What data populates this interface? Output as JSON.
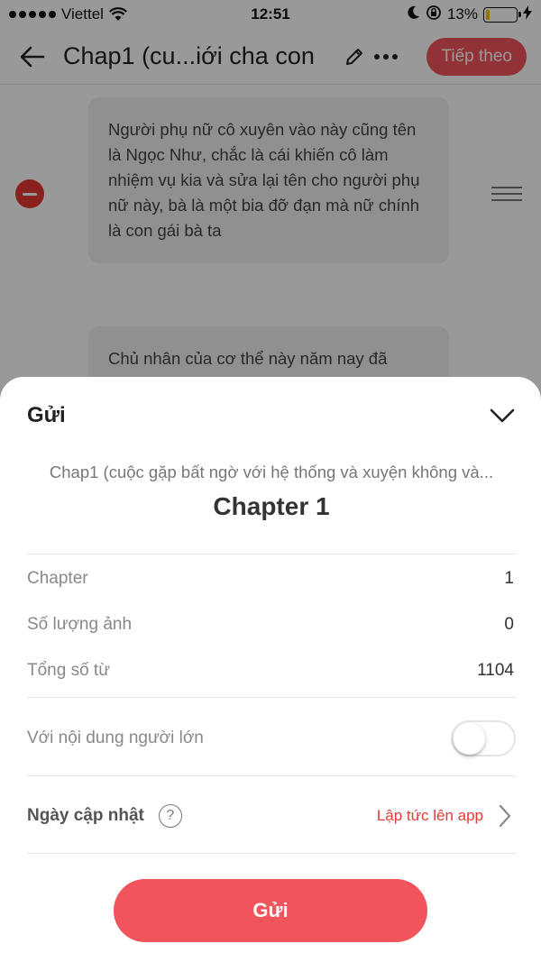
{
  "status_bar": {
    "carrier": "Viettel",
    "time": "12:51",
    "battery": "13%"
  },
  "header": {
    "title": "Chap1 (cu...iới cha con",
    "next_label": "Tiếp theo"
  },
  "paragraphs": [
    "Người phụ nữ cô xuyên vào này cũng tên là Ngọc Như, chắc là cái khiến cô làm nhiệm vụ kia và sửa lại tên cho người phụ nữ này, bà là một bia đỡ đạn mà nữ chính là con gái bà ta",
    "Chủ nhân của cơ thể này năm nay đã"
  ],
  "sheet": {
    "title": "Gửi",
    "story_title": "Chap1 (cuộc gặp bất ngờ với hệ thống và xuyện không và...",
    "chapter_title": "Chapter 1",
    "info": {
      "chapter_label": "Chapter",
      "chapter_value": "1",
      "images_label": "Số lượng ảnh",
      "images_value": "0",
      "words_label": "Tổng số từ",
      "words_value": "1104"
    },
    "adult_label": "Với nội dung người lớn",
    "adult_enabled": false,
    "update_label": "Ngày cập nhật",
    "help_glyph": "?",
    "update_value": "Lập tức lên app",
    "send_label": "Gửi"
  },
  "colors": {
    "accent": "#f2545b",
    "danger": "#e53935",
    "battery_fill": "#f2c200"
  }
}
